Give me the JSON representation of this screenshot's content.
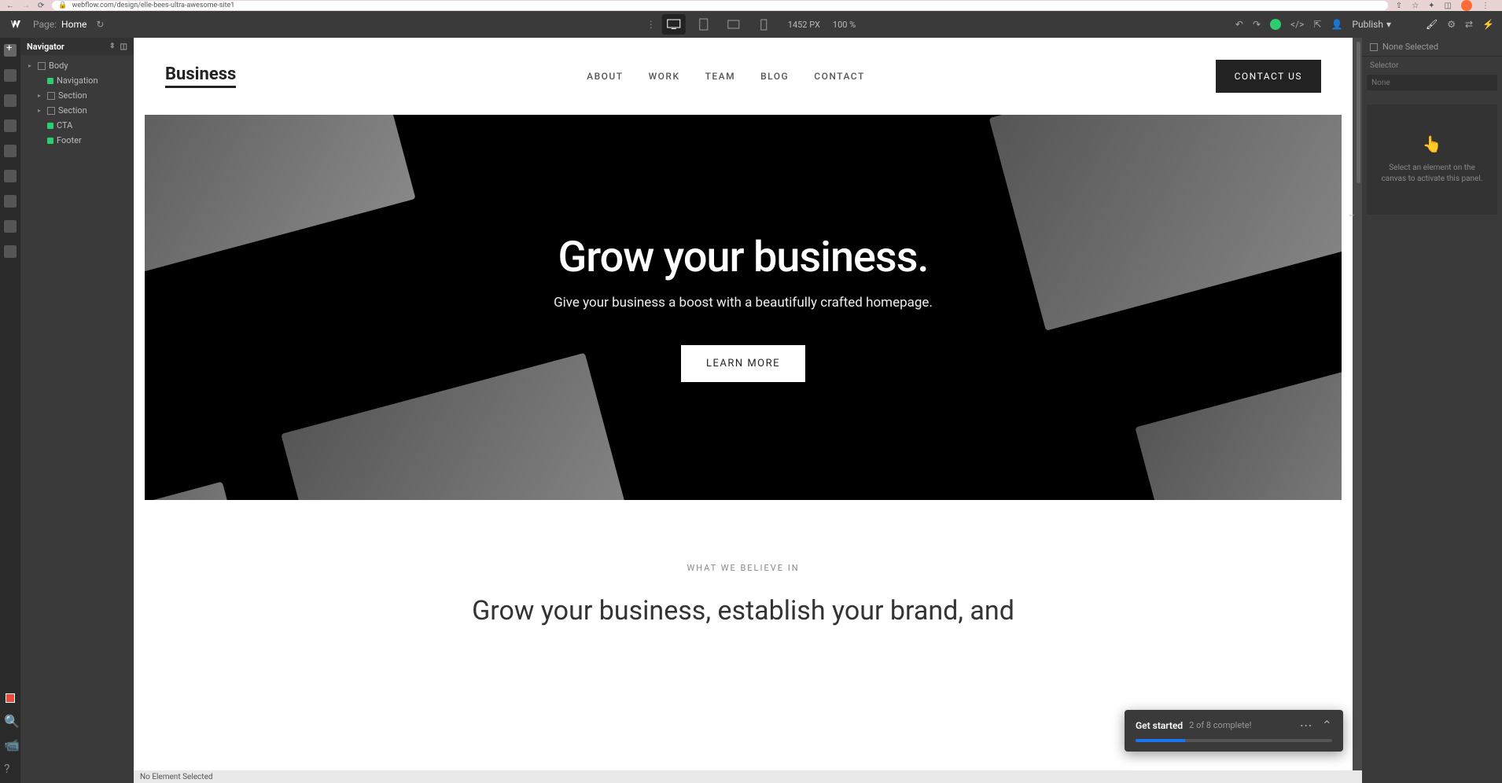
{
  "browser": {
    "url": "webflow.com/design/elle-bees-ultra-awesome-site1"
  },
  "toolbar": {
    "page_label": "Page:",
    "page_name": "Home",
    "canvas_width": "1452 PX",
    "zoom": "100 %",
    "publish": "Publish"
  },
  "navigator": {
    "title": "Navigator",
    "nodes": [
      {
        "label": "Body",
        "indent": 0,
        "expandable": true,
        "green": false
      },
      {
        "label": "Navigation",
        "indent": 1,
        "expandable": false,
        "green": true
      },
      {
        "label": "Section",
        "indent": 1,
        "expandable": true,
        "green": false
      },
      {
        "label": "Section",
        "indent": 1,
        "expandable": true,
        "green": false
      },
      {
        "label": "CTA",
        "indent": 1,
        "expandable": false,
        "green": true
      },
      {
        "label": "Footer",
        "indent": 1,
        "expandable": false,
        "green": true
      }
    ]
  },
  "canvas": {
    "logo": "Business",
    "menu": [
      "ABOUT",
      "WORK",
      "TEAM",
      "BLOG",
      "CONTACT"
    ],
    "contact_btn": "CONTACT US",
    "hero_title": "Grow your business.",
    "hero_sub": "Give your business a boost with a beautifully crafted homepage.",
    "learn_btn": "LEARN MORE",
    "sec2_eyebrow": "WHAT WE BELIEVE IN",
    "sec2_title": "Grow your business, establish your brand, and"
  },
  "get_started": {
    "title": "Get started",
    "progress_text": "2 of 8 complete!"
  },
  "status_bar": {
    "text": "No Element Selected"
  },
  "right_panel": {
    "none_selected": "None Selected",
    "selector_label": "Selector",
    "selector_value": "None",
    "empty_text": "Select an element on the canvas to activate this panel."
  }
}
